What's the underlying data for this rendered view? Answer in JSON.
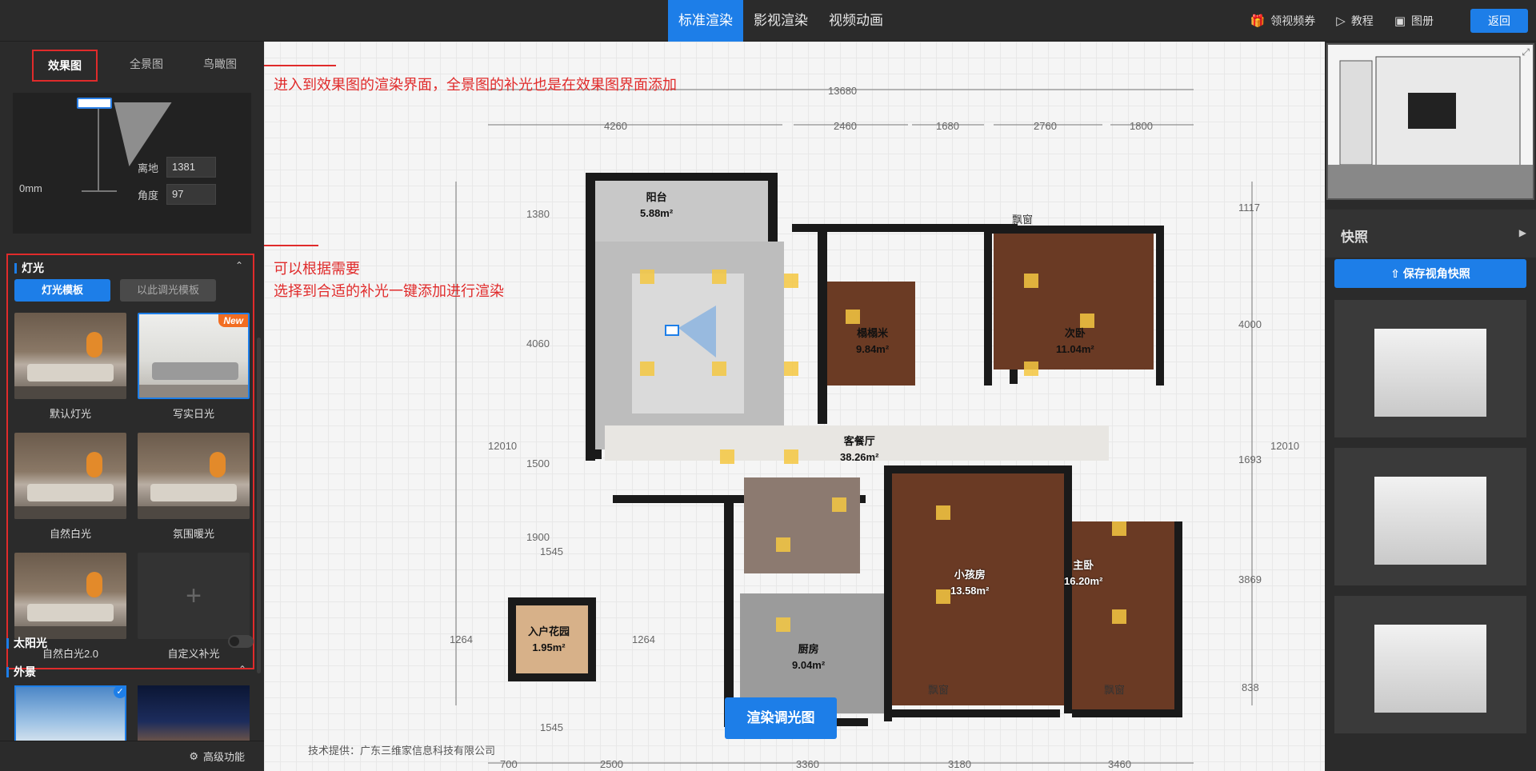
{
  "topbar": {
    "tabs": [
      {
        "label": "标准渲染",
        "active": true
      },
      {
        "label": "影视渲染",
        "active": false
      },
      {
        "label": "视频动画",
        "active": false
      }
    ],
    "coupon": "领视频券",
    "tutorial": "教程",
    "album": "图册",
    "back": "返回"
  },
  "left": {
    "view_tabs": [
      "效果图",
      "全景图",
      "鸟瞰图"
    ],
    "camera": {
      "height_label": "0mm",
      "ground_label": "离地",
      "ground_value": "1381",
      "angle_label": "角度",
      "angle_value": "97",
      "angle_unit": "°"
    },
    "light": {
      "title": "灯光",
      "tab_template": "灯光模板",
      "tab_custom": "以此调光模板",
      "templates": [
        {
          "name": "默认灯光",
          "style": "warm"
        },
        {
          "name": "写实日光",
          "style": "bright",
          "badge": "New"
        },
        {
          "name": "自然白光",
          "style": "warm"
        },
        {
          "name": "氛围暖光",
          "style": "warm"
        },
        {
          "name": "自然白光2.0",
          "style": "warm"
        },
        {
          "name": "自定义补光",
          "style": "plus"
        }
      ]
    },
    "sun": {
      "title": "太阳光"
    },
    "scene": {
      "title": "外景"
    },
    "advanced": "高级功能"
  },
  "canvas": {
    "annotation1": "进入到效果图的渲染界面，全景图的补光也是在效果图界面添加",
    "annotation2_line1": "可以根据需要",
    "annotation2_line2": "选择到合适的补光一键添加进行渲染",
    "dims_top": [
      "13680",
      "4260",
      "2460",
      "1680",
      "2760",
      "1800"
    ],
    "dims_bottom": [
      "700",
      "2500",
      "3360",
      "3180",
      "3460"
    ],
    "dims_left": [
      "1380",
      "4060",
      "12010",
      "1500",
      "1900",
      "1545",
      "1264",
      "1545"
    ],
    "dims_right": [
      "1117",
      "4000",
      "12010",
      "1693",
      "3869",
      "838"
    ],
    "dim_1264_right": "1264",
    "rooms": [
      {
        "name": "阳台",
        "area": "5.88m²"
      },
      {
        "name": "榻榻米",
        "area": "9.84m²"
      },
      {
        "name": "次卧",
        "area": "11.04m²"
      },
      {
        "name": "客餐厅",
        "area": "38.26m²"
      },
      {
        "name": "入户花园",
        "area": "1.95m²"
      },
      {
        "name": "厨房",
        "area": "9.04m²"
      },
      {
        "name": "小孩房",
        "area": "13.58m²"
      },
      {
        "name": "主卧",
        "area": "16.20m²"
      }
    ],
    "window_labels": [
      "飘窗",
      "飘窗",
      "飘窗"
    ],
    "render_button": "渲染调光图",
    "credit": "技术提供：广东三维家信息科技有限公司"
  },
  "right": {
    "snapshot_title": "快照",
    "save_button": "保存视角快照"
  },
  "colors": {
    "accent": "#1d7ee8",
    "annotation": "#e02b2b",
    "new_badge": "#f26d21"
  }
}
